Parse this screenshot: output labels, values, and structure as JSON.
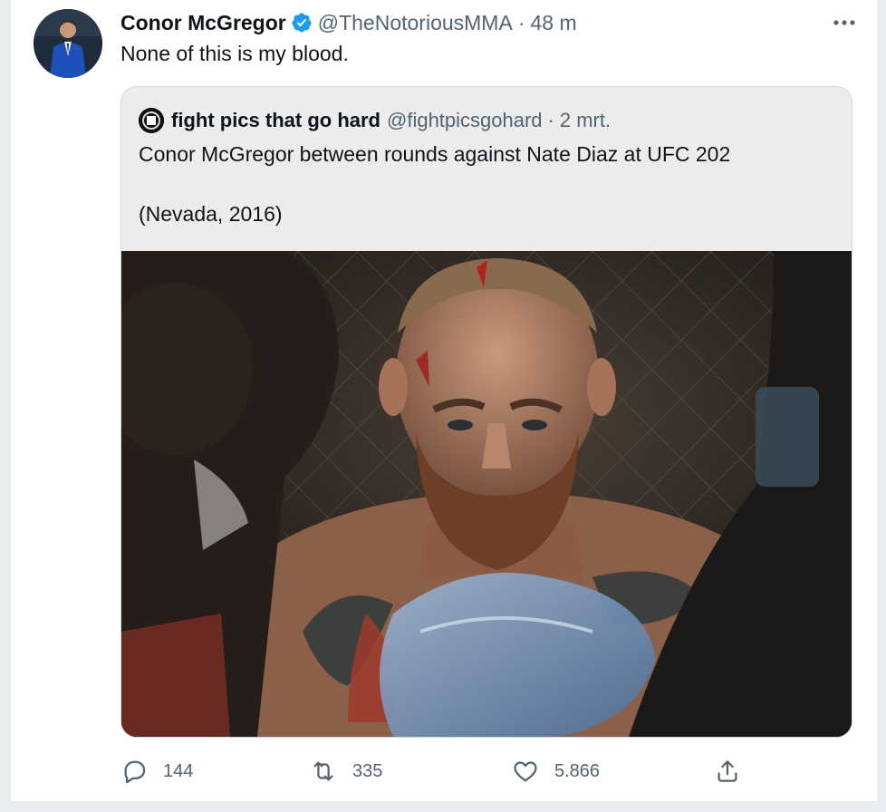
{
  "tweet": {
    "display_name": "Conor McGregor",
    "handle": "@TheNotoriousMMA",
    "separator": "·",
    "time": "48 m",
    "text": "None of this is my blood."
  },
  "quote": {
    "display_name": "fight pics that go hard",
    "handle": "@fightpicsgohard",
    "separator": "·",
    "time": "2 mrt.",
    "text_line1": "Conor McGregor between rounds against Nate Diaz at UFC 202",
    "text_line2": "(Nevada, 2016)"
  },
  "actions": {
    "replies": "144",
    "retweets": "335",
    "likes": "5.866"
  },
  "icons": {
    "verified": "verified-badge-icon",
    "more": "more-dots-icon",
    "reply": "reply-bubble-icon",
    "retweet": "retweet-icon",
    "like": "heart-icon",
    "share": "share-upload-icon"
  },
  "colors": {
    "verified_blue": "#1d9bf0",
    "secondary_text": "#536471",
    "border": "#cfd9de"
  }
}
